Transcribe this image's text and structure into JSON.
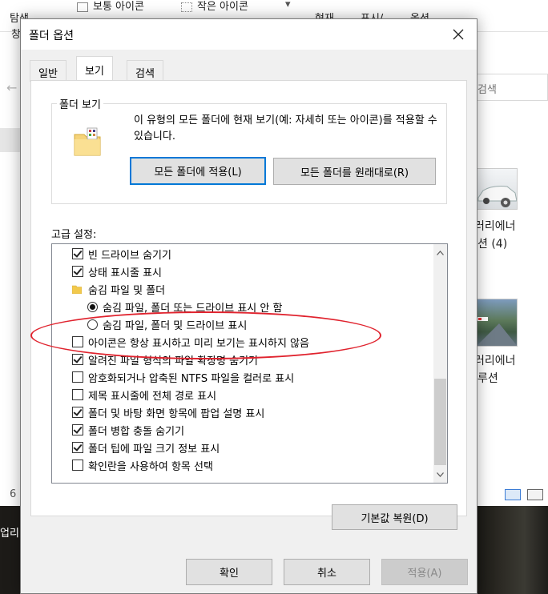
{
  "background": {
    "ribbon_left_1": "탐색",
    "ribbon_left_2": "창",
    "normal_icons": "보통 아이콘",
    "small_icons": "작은 아이콘",
    "current": "현재",
    "show": "표시/",
    "options": "옵션",
    "search_placeholder": "검색",
    "file1_line1": "러리에너",
    "file1_line2": "션 (4)",
    "file2_line1": "러리에너",
    "file2_line2": "루션",
    "status_left": "6",
    "upload_label": "업리"
  },
  "dialog": {
    "title": "폴더 옵션",
    "close_icon": "close-icon",
    "tabs": [
      {
        "label": "일반"
      },
      {
        "label": "보기"
      },
      {
        "label": "검색"
      }
    ],
    "active_tab": "보기",
    "folder_view": {
      "legend": "폴더 보기",
      "description": "이 유형의 모든 폴더에 현재 보기(예: 자세히 또는 아이콘)를 적용할 수 있습니다.",
      "apply_all_button": "모든 폴더에 적용(L)",
      "reset_all_button": "모든 폴더를 원래대로(R)"
    },
    "advanced": {
      "label": "고급 설정:",
      "items": [
        {
          "type": "checkbox",
          "checked": true,
          "label": "빈 드라이브 숨기기"
        },
        {
          "type": "checkbox",
          "checked": true,
          "label": "상태 표시줄 표시"
        },
        {
          "type": "folder",
          "label": "숨김 파일 및 폴더"
        },
        {
          "type": "radio",
          "checked": true,
          "label": "숨김 파일, 폴더 또는 드라이브 표시 안 함"
        },
        {
          "type": "radio",
          "checked": false,
          "label": "숨김 파일, 폴더 및 드라이브 표시"
        },
        {
          "type": "checkbox",
          "checked": false,
          "label": "아이콘은 항상 표시하고 미리 보기는 표시하지 않음"
        },
        {
          "type": "checkbox",
          "checked": true,
          "label": "알려진 파일 형식의 파일 확장명 숨기기"
        },
        {
          "type": "checkbox",
          "checked": false,
          "label": "암호화되거나 압축된 NTFS 파일을 컬러로 표시"
        },
        {
          "type": "checkbox",
          "checked": false,
          "label": "제목 표시줄에 전체 경로 표시"
        },
        {
          "type": "checkbox",
          "checked": true,
          "label": "폴더 및 바탕 화면 항목에 팝업 설명 표시"
        },
        {
          "type": "checkbox",
          "checked": true,
          "label": "폴더 병합 충돌 숨기기"
        },
        {
          "type": "checkbox",
          "checked": true,
          "label": "폴더 팁에 파일 크기 정보 표시"
        },
        {
          "type": "checkbox",
          "checked": false,
          "label": "확인란을 사용하여 항목 선택"
        }
      ],
      "scroll_position": 0.72
    },
    "restore_defaults_button": "기본값 복원(D)",
    "ok_button": "확인",
    "cancel_button": "취소",
    "apply_button": "적용(A)",
    "highlight_color": "#e0232e",
    "focus_color": "#0078d7"
  }
}
